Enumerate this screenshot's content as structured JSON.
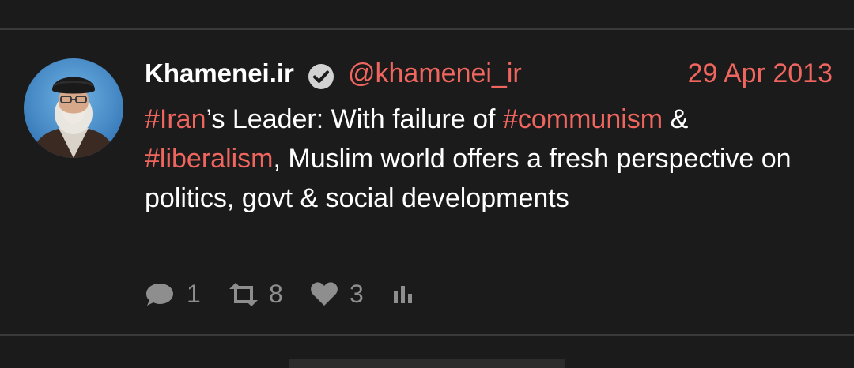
{
  "tweet": {
    "author": {
      "display_name": "Khamenei.ir",
      "handle": "@khamenei_ir",
      "verified": true
    },
    "date": "29 Apr 2013",
    "text_segments": {
      "s1": "#Iran",
      "s2": "’s Leader: With failure of ",
      "s3": "#communism",
      "s4": " & ",
      "s5": "#liberalism",
      "s6": ", Muslim world offers a fresh perspective on politics, govt & social developments"
    },
    "actions": {
      "replies": "1",
      "retweets": "8",
      "likes": "3"
    }
  },
  "colors": {
    "background": "#1b1b1b",
    "accent": "#f0665f",
    "text": "#ffffff",
    "muted": "#8e8e8e",
    "divider": "#3a3a3a"
  },
  "icons": {
    "verified": "verified-check-icon",
    "reply": "speech-bubble-icon",
    "retweet": "retweet-arrows-icon",
    "like": "heart-icon",
    "stats": "bar-chart-icon"
  }
}
